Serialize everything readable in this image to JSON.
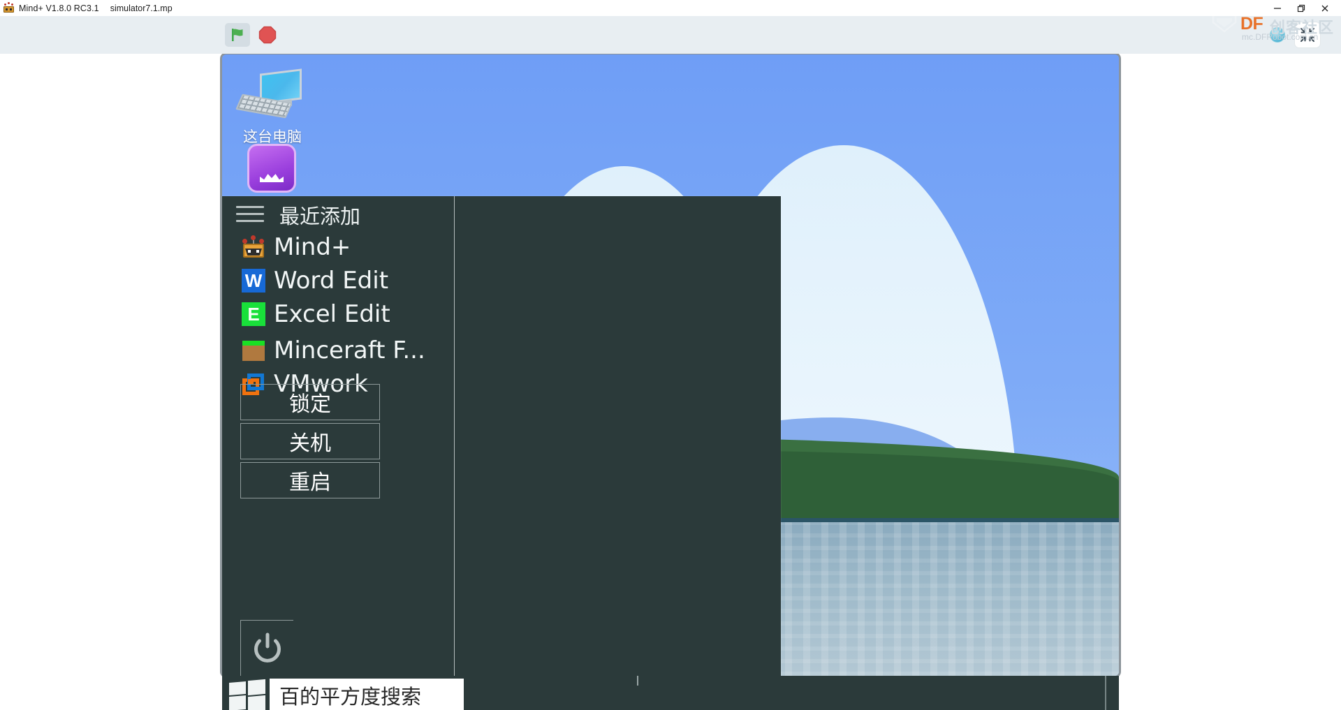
{
  "titlebar": {
    "app_icon": "mind-plus-robot-icon",
    "app_title": "Mind+ V1.8.0 RC3.1",
    "file_name": "simulator7.1.mp",
    "minimize_label": "minimize-icon",
    "restore_label": "restore-icon",
    "close_label": "close-icon"
  },
  "watermark": {
    "brand": "DF",
    "brand_cn": "创客社区",
    "url": "mc.DFRobot.com.cn"
  },
  "toolbar": {
    "green_flag": "green-flag-icon",
    "stop": "stop-sign-icon",
    "globe": "globe-icon",
    "shrink": "shrink-screen-icon"
  },
  "desktop": {
    "icons": [
      {
        "label": "这台电脑",
        "icon": "this-pc-icon"
      },
      {
        "label": "",
        "icon": "purple-app-icon"
      }
    ]
  },
  "start_menu": {
    "hamburger": "hamburger-menu-icon",
    "section_title": "最近添加",
    "apps": [
      {
        "label": "Mind+",
        "icon": "mind-plus-icon"
      },
      {
        "label": "Word Edit",
        "icon": "word-icon",
        "glyph": "W"
      },
      {
        "label": "Excel Edit",
        "icon": "excel-icon",
        "glyph": "E"
      },
      {
        "label": "Minceraft F...",
        "icon": "minecraft-icon"
      },
      {
        "label": "VMwork",
        "icon": "vmware-icon"
      }
    ],
    "actions": [
      {
        "label": "锁定"
      },
      {
        "label": "关机"
      },
      {
        "label": "重启"
      }
    ],
    "power_button": "power-icon"
  },
  "taskbar": {
    "start_button": "windows-logo-icon",
    "search_value": "百的平方度搜索",
    "search_placeholder": "搜索"
  },
  "colors": {
    "toolbar_bg": "#e8eef2",
    "menu_bg": "#2b3a3a",
    "accent_orange": "#e8722a",
    "flag_green": "#4caf50",
    "stop_red": "#e05353",
    "word_blue": "#1769d6",
    "excel_green": "#19e03a"
  }
}
